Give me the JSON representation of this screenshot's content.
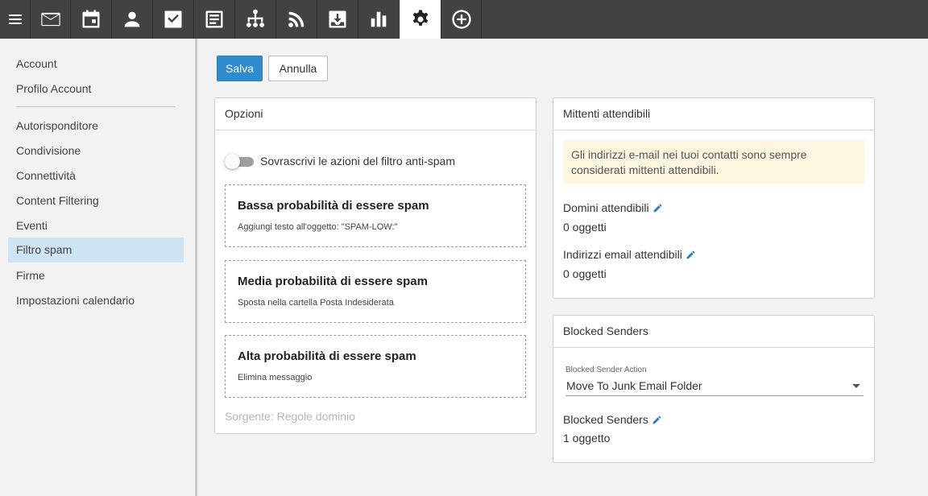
{
  "toolbar": {
    "icons": [
      "menu-icon",
      "mail-icon",
      "calendar-icon",
      "contacts-icon",
      "tasks-icon",
      "notes-icon",
      "documents-icon",
      "rss-icon",
      "download-icon",
      "reports-icon",
      "settings-icon",
      "add-icon"
    ],
    "active": "settings-icon"
  },
  "sidebar": {
    "items": [
      {
        "label": "Account"
      },
      {
        "label": "Profilo Account"
      },
      {
        "label": "Autorisponditore"
      },
      {
        "label": "Condivisione"
      },
      {
        "label": "Connettività"
      },
      {
        "label": "Content Filtering"
      },
      {
        "label": "Eventi"
      },
      {
        "label": "Filtro spam",
        "active": true
      },
      {
        "label": "Firme"
      },
      {
        "label": "Impostazioni calendario"
      }
    ]
  },
  "actions": {
    "save_label": "Salva",
    "cancel_label": "Annulla"
  },
  "options": {
    "title": "Opzioni",
    "toggle_label": "Sovrascrivi le azioni del filtro anti-spam",
    "toggle_on": false,
    "rules": [
      {
        "title": "Bassa probabilità di essere spam",
        "desc": "Aggiungi testo all'oggetto: \"SPAM-LOW:\""
      },
      {
        "title": "Media probabilità di essere spam",
        "desc": "Sposta nella cartella Posta Indesiderata"
      },
      {
        "title": "Alta probabilità di essere spam",
        "desc": "Elimina messaggio"
      }
    ],
    "source": "Sorgente: Regole dominio"
  },
  "trusted": {
    "title": "Mittenti attendibili",
    "info": "Gli indirizzi e-mail nei tuoi contatti sono sempre considerati mittenti attendibili.",
    "domains_label": "Domini attendibili",
    "domains_value": "0 oggetti",
    "emails_label": "Indirizzi email attendibili",
    "emails_value": "0 oggetti"
  },
  "blocked": {
    "title": "Blocked Senders",
    "action_label": "Blocked Sender Action",
    "action_value": "Move To Junk Email Folder",
    "senders_label": "Blocked Senders",
    "senders_value": "1 oggetto"
  },
  "colors": {
    "primary": "#2e8bce",
    "topbar": "#424242",
    "active_nav": "#cfe4f3",
    "info_bg": "#fcf6e0"
  }
}
